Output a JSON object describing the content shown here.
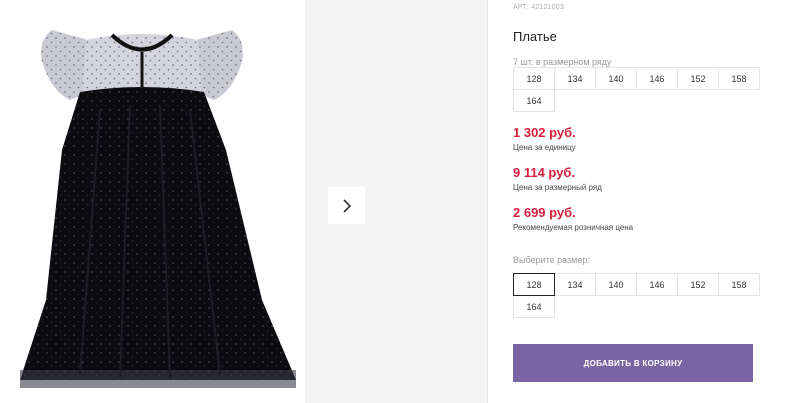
{
  "product": {
    "article": "АРТ: 42121003",
    "title": "Платье"
  },
  "series": {
    "note": "7 шт. в размерном ряду",
    "sizes": [
      "128",
      "134",
      "140",
      "146",
      "152",
      "158",
      "164"
    ]
  },
  "prices": [
    {
      "value": "1 302 руб.",
      "label": "Цена за единицу"
    },
    {
      "value": "9 114 руб.",
      "label": "Цена за размерный ряд"
    },
    {
      "value": "2 699 руб.",
      "label": "Рекомендуемая розничная цена"
    }
  ],
  "size_picker": {
    "label": "Выберите размер:",
    "options": [
      "128",
      "134",
      "140",
      "146",
      "152",
      "158",
      "164"
    ],
    "selected": "128"
  },
  "cart_button": {
    "label": "ДОБАВИТЬ В КОРЗИНУ"
  },
  "gallery": {
    "next_icon": "chevron-right-icon"
  },
  "colors": {
    "price": "#d81e3c",
    "button": "#7b64a3",
    "dress": "#0b0b10"
  }
}
